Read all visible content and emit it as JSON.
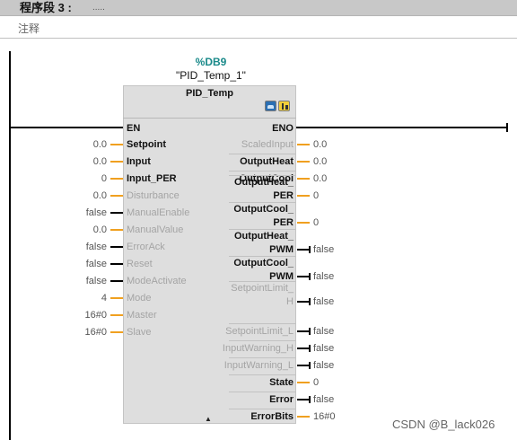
{
  "segment": {
    "title": "程序段 3 :",
    "dots": "....."
  },
  "comment": "注释",
  "instance": {
    "db": "%DB9",
    "name": "\"PID_Temp_1\"",
    "block_type": "PID_Temp"
  },
  "enable": {
    "en": "EN",
    "eno": "ENO"
  },
  "inputs": [
    {
      "label": "Setpoint",
      "value": "0.0",
      "state": "on"
    },
    {
      "label": "Input",
      "value": "0.0",
      "state": "on"
    },
    {
      "label": "Input_PER",
      "value": "0",
      "state": "on"
    },
    {
      "label": "Disturbance",
      "value": "0.0",
      "state": "off"
    },
    {
      "label": "ManualEnable",
      "value": "false",
      "state": "off"
    },
    {
      "label": "ManualValue",
      "value": "0.0",
      "state": "off"
    },
    {
      "label": "ErrorAck",
      "value": "false",
      "state": "off"
    },
    {
      "label": "Reset",
      "value": "false",
      "state": "off"
    },
    {
      "label": "ModeActivate",
      "value": "false",
      "state": "off"
    },
    {
      "label": "Mode",
      "value": "4",
      "state": "off"
    },
    {
      "label": "Master",
      "value": "16#0",
      "state": "off"
    },
    {
      "label": "Slave",
      "value": "16#0",
      "state": "off"
    }
  ],
  "outputs": [
    {
      "line1": "",
      "line2": "ScaledInput",
      "value": "0.0",
      "state": "off"
    },
    {
      "line1": "",
      "line2": "OutputHeat",
      "value": "0.0",
      "state": "on"
    },
    {
      "line1": "",
      "line2": "OutputCool",
      "value": "0.0",
      "state": "on"
    },
    {
      "line1": "OutputHeat_",
      "line2": "PER",
      "value": "0",
      "state": "on"
    },
    {
      "line1": "OutputCool_",
      "line2": "PER",
      "value": "0",
      "state": "on"
    },
    {
      "line1": "OutputHeat_",
      "line2": "PWM",
      "value": "false",
      "state": "on"
    },
    {
      "line1": "OutputCool_",
      "line2": "PWM",
      "value": "false",
      "state": "on"
    },
    {
      "line1": "SetpointLimit_",
      "line2": "H",
      "value": "false",
      "state": "off"
    },
    {
      "line1": "",
      "line2": "SetpointLimit_L",
      "value": "false",
      "state": "off"
    },
    {
      "line1": "",
      "line2": "InputWarning_H",
      "value": "false",
      "state": "off"
    },
    {
      "line1": "",
      "line2": "InputWarning_L",
      "value": "false",
      "state": "off"
    },
    {
      "line1": "",
      "line2": "State",
      "value": "0",
      "state": "on"
    },
    {
      "line1": "",
      "line2": "Error",
      "value": "false",
      "state": "on"
    },
    {
      "line1": "",
      "line2": "ErrorBits",
      "value": "16#0",
      "state": "on"
    }
  ],
  "watermark": "CSDN @B_lack026",
  "colors": {
    "db": "#1a8a8a",
    "wire_numeric": "#f0a020",
    "wire_bool": "#000000",
    "block": "#dedede",
    "header": "#c8c8c8"
  }
}
